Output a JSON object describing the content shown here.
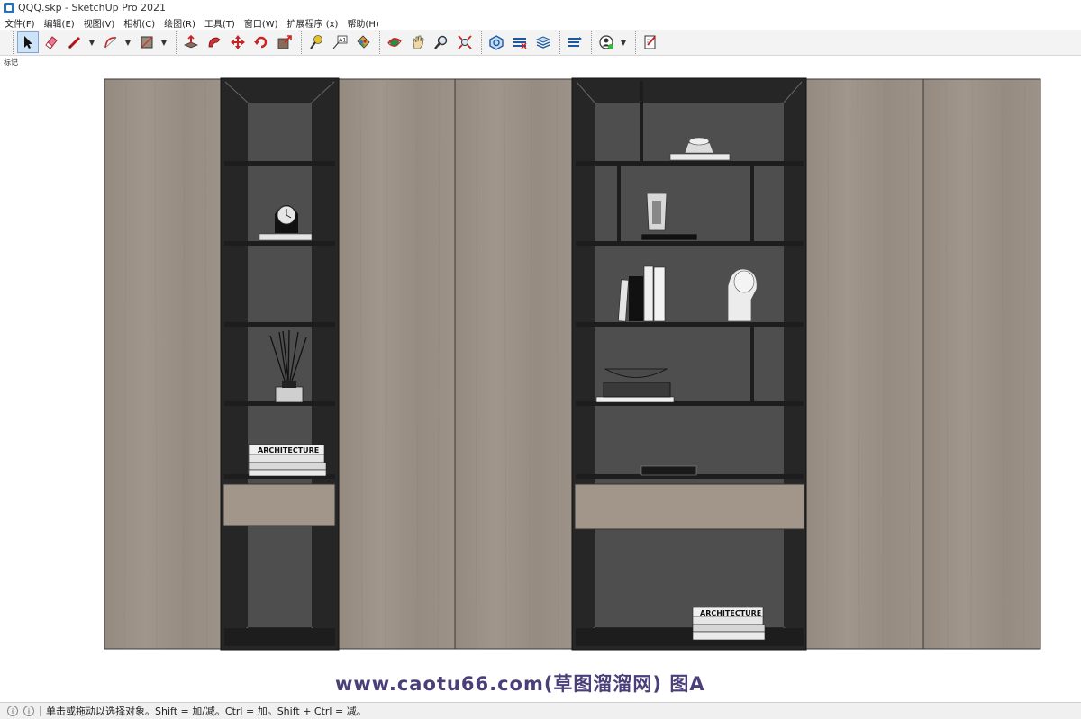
{
  "window": {
    "title": "QQQ.skp - SketchUp Pro 2021"
  },
  "menu": [
    "文件(F)",
    "编辑(E)",
    "视图(V)",
    "相机(C)",
    "绘图(R)",
    "工具(T)",
    "窗口(W)",
    "扩展程序 (x)",
    "帮助(H)"
  ],
  "tag_label": "标记",
  "toolbar": {
    "tools": [
      {
        "name": "select-icon"
      },
      {
        "name": "eraser-icon"
      },
      {
        "name": "line-icon"
      },
      {
        "name": "arc-icon"
      },
      {
        "name": "rectangle-icon"
      },
      {
        "name": "push-pull-icon"
      },
      {
        "name": "follow-me-icon"
      },
      {
        "name": "move-icon"
      },
      {
        "name": "rotate-icon"
      },
      {
        "name": "scale-icon"
      },
      {
        "name": "tape-measure-icon"
      },
      {
        "name": "text-icon"
      },
      {
        "name": "paint-bucket-icon"
      },
      {
        "name": "orbit-icon"
      },
      {
        "name": "pan-icon"
      },
      {
        "name": "zoom-icon"
      },
      {
        "name": "zoom-extents-icon"
      },
      {
        "name": "warehouse-icon"
      },
      {
        "name": "extension-warehouse-icon"
      },
      {
        "name": "layout-icon"
      },
      {
        "name": "extension-manager-icon"
      },
      {
        "name": "account-icon"
      },
      {
        "name": "model-info-icon"
      }
    ]
  },
  "scene": {
    "book_label_1": "ARCHITECTURE",
    "book_label_2": "ARCHITECTURE"
  },
  "watermark": "www.caotu66.com(草图溜溜网) 图A",
  "status": {
    "text": "单击或拖动以选择对象。Shift = 加/减。Ctrl = 加。Shift + Ctrl = 减。"
  }
}
